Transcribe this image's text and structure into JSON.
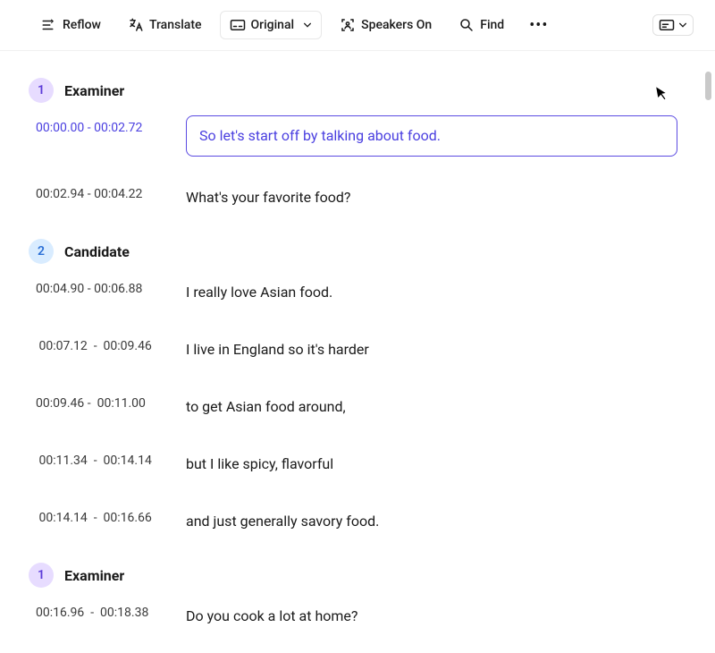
{
  "toolbar": {
    "reflow": "Reflow",
    "translate": "Translate",
    "original": "Original",
    "speakers": "Speakers On",
    "find": "Find"
  },
  "segments": [
    {
      "speaker": {
        "num": "1",
        "name": "Examiner",
        "color": "purple"
      },
      "lines": [
        {
          "ts": "00:00.00 - 00:02.72",
          "text": "So let's start off by talking about food.",
          "active": true
        },
        {
          "ts": "00:02.94 - 00:04.22",
          "text": "What's your favorite food?"
        }
      ]
    },
    {
      "speaker": {
        "num": "2",
        "name": "Candidate",
        "color": "blue"
      },
      "lines": [
        {
          "ts": "00:04.90 - 00:06.88",
          "text": "I really love Asian food."
        },
        {
          "ts": " 00:07.12  -  00:09.46",
          "text": "I live in England so it's harder"
        },
        {
          "ts": "00:09.46 -  00:11.00",
          "text": "to get Asian food around,"
        },
        {
          "ts": " 00:11.34  -  00:14.14",
          "text": "but I like spicy, flavorful"
        },
        {
          "ts": " 00:14.14  -  00:16.66",
          "text": "and just generally savory food."
        }
      ]
    },
    {
      "speaker": {
        "num": "1",
        "name": "Examiner",
        "color": "purple"
      },
      "lines": [
        {
          "ts": "00:16.96  -  00:18.38",
          "text": "Do you cook a lot at home?"
        }
      ]
    }
  ]
}
